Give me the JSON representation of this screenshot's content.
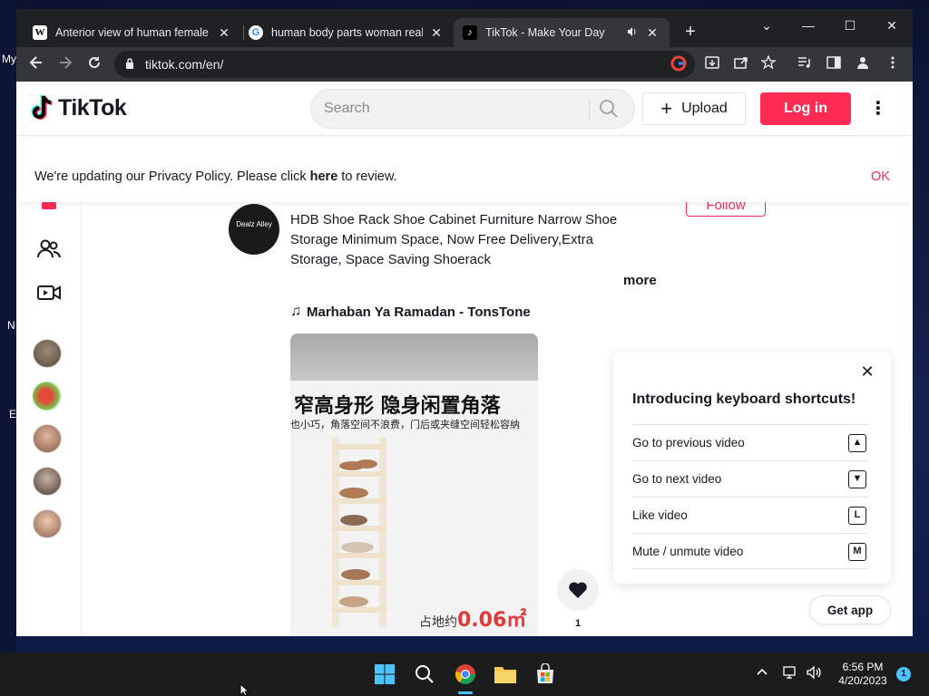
{
  "desktop": {
    "labels": [
      "My",
      "N",
      "E"
    ]
  },
  "browser": {
    "tabs": [
      {
        "title": "Anterior view of human female a",
        "favicon": "W",
        "favicon_icon": "wikipedia-icon"
      },
      {
        "title": "human body parts woman real -",
        "favicon": "G",
        "favicon_icon": "google-icon"
      },
      {
        "title": "TikTok - Make Your Day",
        "favicon": "♪",
        "favicon_icon": "tiktok-icon",
        "active": true
      }
    ],
    "close_glyph": "✕",
    "new_tab_glyph": "+",
    "address": "tiktok.com/en/",
    "window_controls": {
      "dropdown": "⌄",
      "minimize": "—",
      "maximize": "☐",
      "close": "✕"
    }
  },
  "tiktok": {
    "logo_text": "TikTok",
    "search_placeholder": "Search",
    "upload_label": "Upload",
    "upload_plus": "+",
    "login_label": "Log in",
    "more_glyph": "⋮",
    "privacy": {
      "text_before": "We're updating our Privacy Policy. Please click ",
      "link": "here",
      "text_after": " to review.",
      "ok": "OK"
    },
    "post": {
      "avatar_text": "Dealz Alley",
      "follow_label": "Follow",
      "caption": "HDB Shoe Rack Shoe Cabinet Furniture Narrow Shoe Storage Minimum Space, Now Free Delivery,Extra Storage, Space Saving Shoerack",
      "more_label": "more",
      "music_note": "♫",
      "music": "Marhaban Ya Ramadan - TonsTone",
      "video_headline": "窄高身形 隐身闲置角落",
      "video_subtext": "也小巧，角落空间不浪费，门后或夹缝空间轻松容纳",
      "video_area_label": "占地约",
      "video_area_value": "0.06㎡",
      "like_count": "1"
    },
    "shortcuts": {
      "title": "Introducing keyboard shortcuts!",
      "close_glyph": "✕",
      "items": [
        {
          "label": "Go to previous video",
          "key": "▲"
        },
        {
          "label": "Go to next video",
          "key": "▼"
        },
        {
          "label": "Like video",
          "key": "L"
        },
        {
          "label": "Mute / unmute video",
          "key": "M"
        }
      ]
    },
    "get_app": "Get app"
  },
  "taskbar": {
    "time": "6:56 PM",
    "date": "4/20/2023",
    "notification_count": "1"
  },
  "colors": {
    "accent": "#fe2c55",
    "chrome_dark": "#202124",
    "chrome_toolbar": "#35363a",
    "taskbar": "#1c1c1c"
  }
}
